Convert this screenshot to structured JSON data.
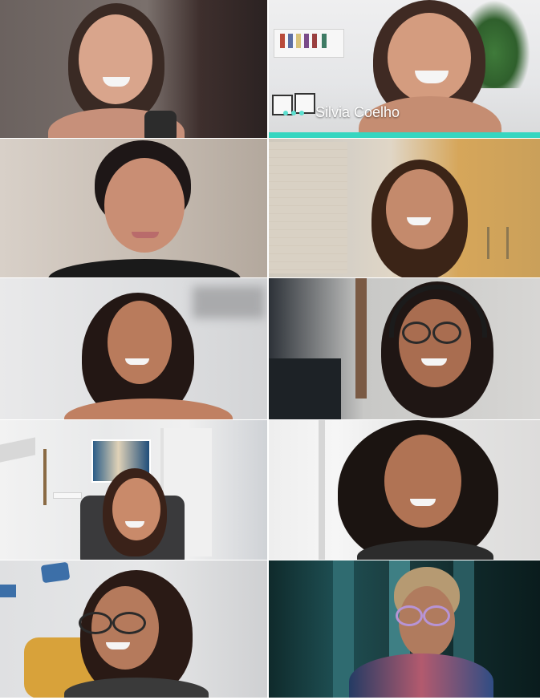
{
  "call": {
    "participants": [
      {
        "id": "p1",
        "name": "",
        "speaking": false
      },
      {
        "id": "p2",
        "name": "Silvia Coelho",
        "speaking": true
      },
      {
        "id": "p3",
        "name": "",
        "speaking": false
      },
      {
        "id": "p4",
        "name": "",
        "speaking": false
      },
      {
        "id": "p5",
        "name": "",
        "speaking": false
      },
      {
        "id": "p6",
        "name": "",
        "speaking": false
      },
      {
        "id": "p7",
        "name": "",
        "speaking": false
      },
      {
        "id": "p8",
        "name": "",
        "speaking": false
      },
      {
        "id": "p9",
        "name": "",
        "speaking": false
      },
      {
        "id": "p10",
        "name": "",
        "speaking": false
      }
    ]
  },
  "colors": {
    "speaking_accent": "#36d6c0",
    "name_text": "#ffffff"
  },
  "icons": {
    "speaking_indicator": "audio-dots-icon"
  }
}
